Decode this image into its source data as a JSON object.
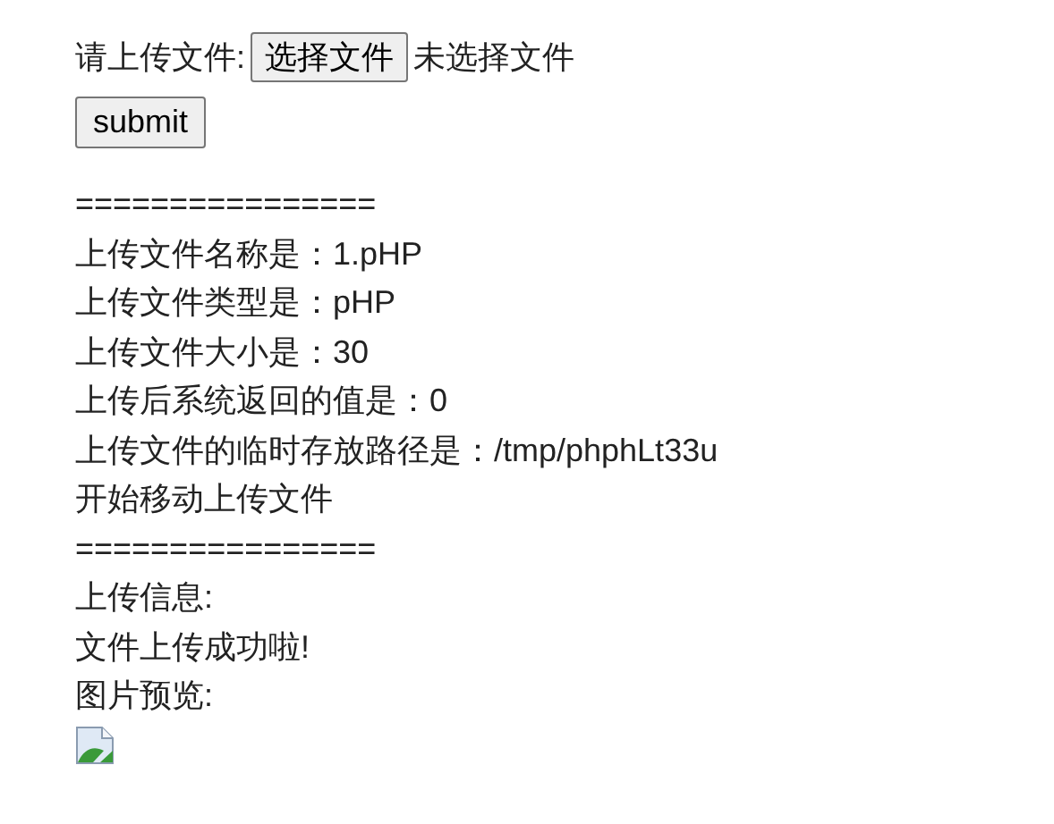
{
  "upload_form": {
    "label": "请上传文件:",
    "file_button": "选择文件",
    "file_status": "未选择文件",
    "submit_button": "submit"
  },
  "output_lines": [
    {
      "kind": "separator",
      "text": "================"
    },
    {
      "kind": "text",
      "text": "上传文件名称是：1.pHP"
    },
    {
      "kind": "text",
      "text": "上传文件类型是：pHP"
    },
    {
      "kind": "text",
      "text": "上传文件大小是：30"
    },
    {
      "kind": "text",
      "text": "上传后系统返回的值是：0"
    },
    {
      "kind": "text",
      "text": "上传文件的临时存放路径是：/tmp/phphLt33u"
    },
    {
      "kind": "text",
      "text": "开始移动上传文件"
    },
    {
      "kind": "separator",
      "text": "================"
    },
    {
      "kind": "text",
      "text": "上传信息:"
    },
    {
      "kind": "text",
      "text": "文件上传成功啦!"
    },
    {
      "kind": "text",
      "text": "图片预览:"
    },
    {
      "kind": "broken_image"
    }
  ]
}
